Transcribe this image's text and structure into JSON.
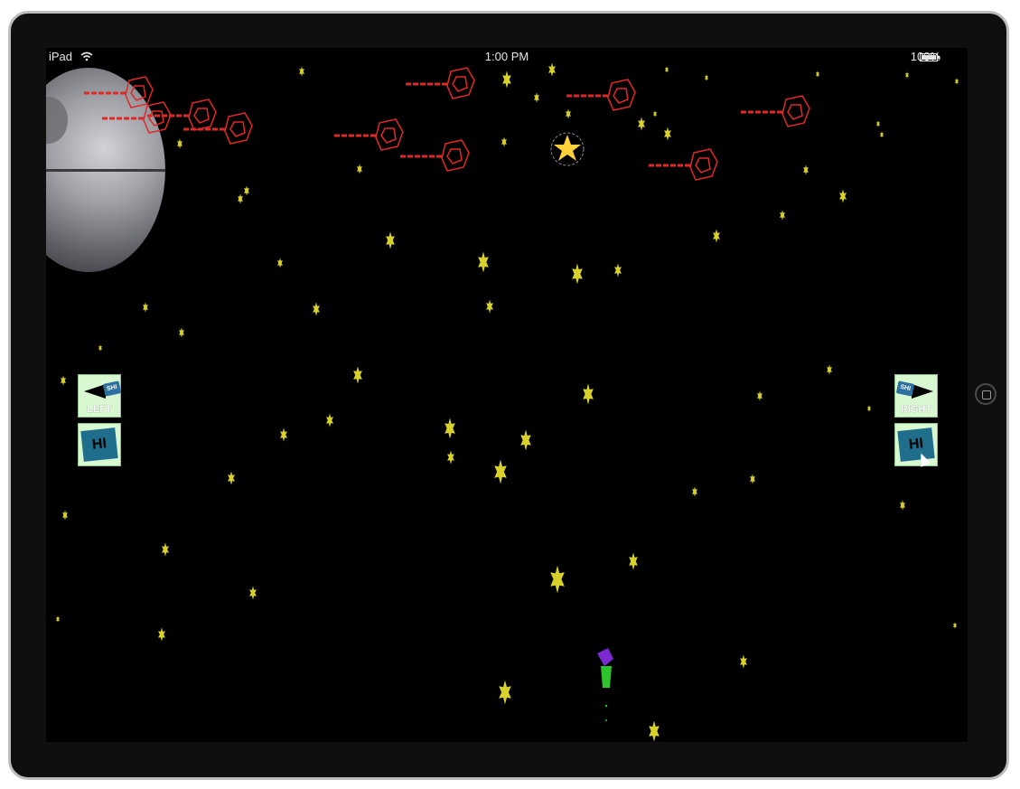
{
  "status_bar": {
    "device": "iPad",
    "time": "1:00 PM",
    "battery": "100%"
  },
  "controls": {
    "left_label": "LEFT",
    "right_label": "RIGHT",
    "badge_text": "SHI",
    "fire_text": "HI"
  },
  "icons": [
    "wifi-icon",
    "battery-icon",
    "home-button-icon",
    "cursor-icon"
  ],
  "colors": {
    "space": "#000000",
    "star": "#d9d12b",
    "enemy": "#e02828",
    "button_bg": "#d9f7d0",
    "player_green": "#2ec42e",
    "player_purple": "#7a2ad0"
  }
}
